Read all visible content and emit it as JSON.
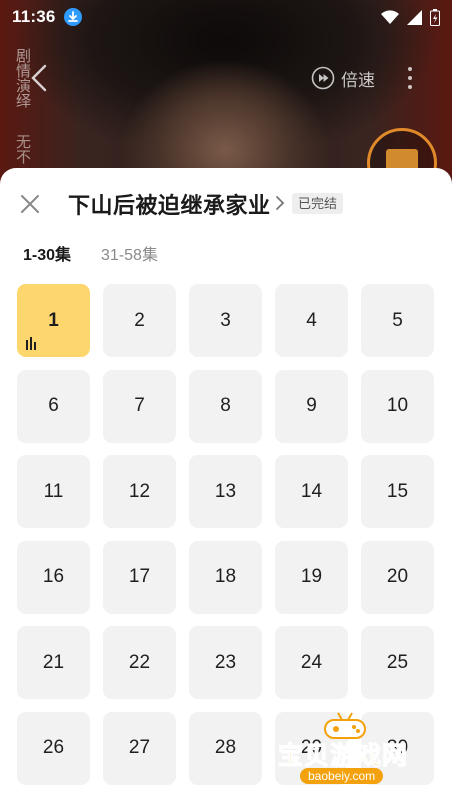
{
  "status_bar": {
    "time": "11:36"
  },
  "player": {
    "side_text_top": "剧情演绎",
    "side_text_bottom": "无不",
    "speed_label": "倍速"
  },
  "sheet": {
    "title": "下山后被迫继承家业",
    "status_tag": "已完结",
    "range_tabs": [
      {
        "label": "1-30集",
        "active": true
      },
      {
        "label": "31-58集",
        "active": false
      }
    ],
    "active_episode": "1",
    "episodes": [
      "1",
      "2",
      "3",
      "4",
      "5",
      "6",
      "7",
      "8",
      "9",
      "10",
      "11",
      "12",
      "13",
      "14",
      "15",
      "16",
      "17",
      "18",
      "19",
      "20",
      "21",
      "22",
      "23",
      "24",
      "25",
      "26",
      "27",
      "28",
      "29",
      "30"
    ]
  },
  "watermark": {
    "text": "宝贝游戏网",
    "url": "baobeiy.com"
  },
  "colors": {
    "active_episode_bg": "#fdd66d",
    "episode_bg": "#f2f2f2",
    "download_badge": "#2f9bff"
  }
}
